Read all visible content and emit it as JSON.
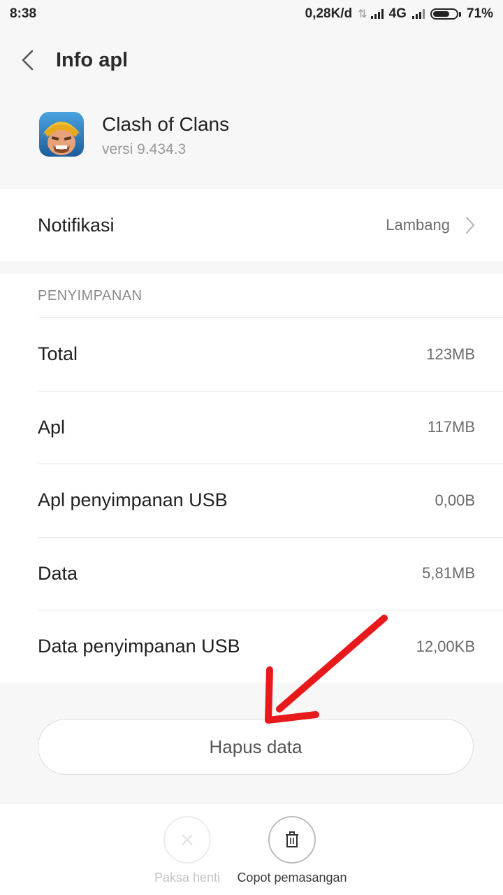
{
  "status_bar": {
    "time": "8:38",
    "net_speed": "0,28K/d",
    "network_type": "4G",
    "battery_percent": "71%",
    "battery_level": 0.71
  },
  "title_bar": {
    "title": "Info apl",
    "back_icon": "chevron-left-icon"
  },
  "app": {
    "name": "Clash of Clans",
    "version": "versi 9.434.3",
    "icon": "clash-of-clans-app-icon"
  },
  "notifications": {
    "label": "Notifikasi",
    "value": "Lambang"
  },
  "storage": {
    "header": "PENYIMPANAN",
    "rows": [
      {
        "label": "Total",
        "value": "123MB"
      },
      {
        "label": "Apl",
        "value": "117MB"
      },
      {
        "label": "Apl penyimpanan USB",
        "value": "0,00B"
      },
      {
        "label": "Data",
        "value": "5,81MB"
      },
      {
        "label": "Data penyimpanan USB",
        "value": "12,00KB"
      }
    ]
  },
  "clear_data_button": "Hapus data",
  "bottom_actions": {
    "force_stop": "Paksa henti",
    "uninstall": "Copot pemasangan"
  },
  "colors": {
    "annotation_arrow": "#e8191b",
    "background": "#f7f7f7",
    "card": "#ffffff"
  }
}
